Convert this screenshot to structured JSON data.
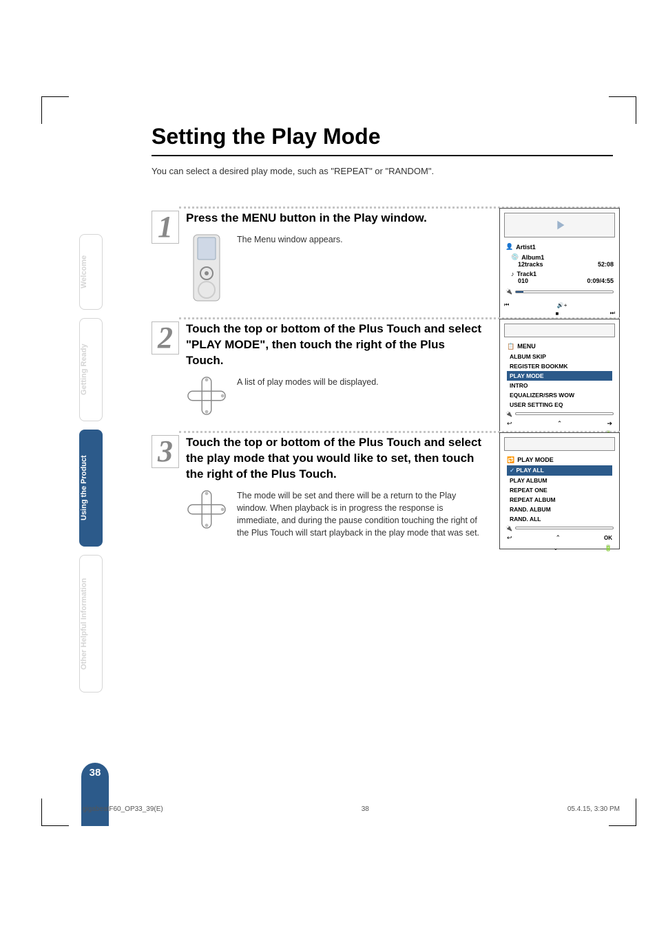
{
  "page": {
    "title": "Setting the Play Mode",
    "intro": "You can select a desired play mode, such as \"REPEAT\" or \"RANDOM\".",
    "page_number": "38"
  },
  "sidebar": {
    "tabs": [
      {
        "label": "Welcome",
        "active": false
      },
      {
        "label": "Getting Ready",
        "active": false
      },
      {
        "label": "Using the Product",
        "active": true
      },
      {
        "label": "Other Helpful Information",
        "active": false
      }
    ]
  },
  "steps": [
    {
      "num": "1",
      "heading": "Press the MENU button in the Play window.",
      "text": "The Menu window appears.",
      "icon": "remote"
    },
    {
      "num": "2",
      "heading": "Touch the top or bottom of the Plus Touch and select \"PLAY MODE\", then touch the right of the Plus Touch.",
      "text": "A list of play modes will be displayed.",
      "icon": "plus"
    },
    {
      "num": "3",
      "heading": "Touch the top or bottom of the Plus Touch and select the play mode that you would like to set, then touch the right of the Plus Touch.",
      "text": "The mode will be set and there will be a return to the Play window. When playback is in progress the response is immediate, and during the pause condition touching the right of the Plus Touch will start playback in the play mode that was set.",
      "icon": "plus"
    }
  ],
  "screens": {
    "play": {
      "artist": "Artist1",
      "album": "Album1",
      "album_tracks": "12tracks",
      "album_time": "52:08",
      "track": "Track1",
      "track_num": "010",
      "track_time": "0:09/4:55"
    },
    "menu": {
      "title": "MENU",
      "items": [
        "ALBUM SKIP",
        "REGISTER BOOKMK",
        "PLAY MODE",
        "INTRO",
        "EQUALIZER/SRS WOW",
        "USER SETTING EQ"
      ],
      "selected_index": 2
    },
    "playmode": {
      "title": "PLAY MODE",
      "items": [
        "PLAY ALL",
        "PLAY ALBUM",
        "REPEAT ONE",
        "REPEAT ALBUM",
        "RAND. ALBUM",
        "RAND. ALL"
      ],
      "selected_index": 0,
      "ok": "OK"
    }
  },
  "footer": {
    "left": "gigabeatF60_OP33_39(E)",
    "center": "38",
    "right": "05.4.15, 3:30 PM"
  }
}
